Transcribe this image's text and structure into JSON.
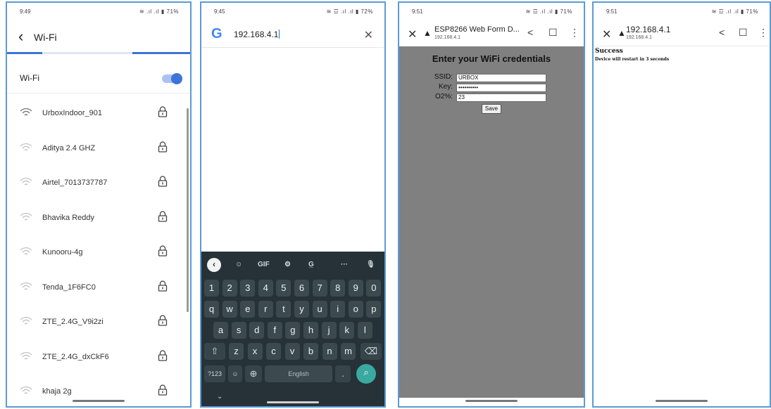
{
  "panel1": {
    "status_time": "9:49",
    "status_icons": "≋ .ıl .ıl ▮ 71%",
    "back_icon": "‹",
    "title": "Wi-Fi",
    "wifi_label": "Wi-Fi",
    "wifi_enabled": true,
    "networks": [
      {
        "name": "UrboxIndoor_901",
        "strength": "strong"
      },
      {
        "name": "Aditya 2.4 GHZ",
        "strength": "weak"
      },
      {
        "name": "Airtel_7013737787",
        "strength": "weak"
      },
      {
        "name": "Bhavika Reddy",
        "strength": "weak"
      },
      {
        "name": "Kunooru-4g",
        "strength": "weak"
      },
      {
        "name": "Tenda_1F6FC0",
        "strength": "weak"
      },
      {
        "name": "ZTE_2.4G_V9i2zi",
        "strength": "weak"
      },
      {
        "name": "ZTE_2.4G_dxCkF6",
        "strength": "weak"
      },
      {
        "name": "khaja 2g",
        "strength": "weak"
      }
    ]
  },
  "panel2": {
    "status_time": "9:45",
    "status_icons": "≋ ☲ .ıl .ıl ▮ 72%",
    "google_logo": "G",
    "url_text": "192.168.4.1",
    "close_icon": "✕",
    "toolbar": {
      "collapse": "‹",
      "sticker": "☺",
      "gif": "GIF",
      "settings": "⚙",
      "translate": "G̲",
      "more": "···",
      "mic": "🎙"
    },
    "keys_row1": [
      "1",
      "2",
      "3",
      "4",
      "5",
      "6",
      "7",
      "8",
      "9",
      "0"
    ],
    "keys_row2": [
      "q",
      "w",
      "e",
      "r",
      "t",
      "y",
      "u",
      "i",
      "o",
      "p"
    ],
    "keys_row3": [
      "a",
      "s",
      "d",
      "f",
      "g",
      "h",
      "j",
      "k",
      "l"
    ],
    "keys_row4": [
      "z",
      "x",
      "c",
      "v",
      "b",
      "n",
      "m"
    ],
    "shift_icon": "⇧",
    "backspace_icon": "⌫",
    "sym_key": "?123",
    "emoji_key": "☺",
    "globe_key": "⊕",
    "space_label": "English",
    "period_key": ".",
    "enter_icon": "⌕",
    "down_icon": "⌄"
  },
  "panel3": {
    "status_time": "9:51",
    "status_icons": "≋ ☲ .ıl .ıl ▮ 71%",
    "close_icon": "✕",
    "warning_icon": "▲",
    "title": "ESP8266 Web Form D...",
    "subtitle": "192.168.4.1",
    "share_icon": "<",
    "bookmark_icon": "☐",
    "menu_icon": "⋮",
    "page_heading": "Enter your WiFi credentials",
    "fields": [
      {
        "label": "SSID:",
        "value": "URBOX"
      },
      {
        "label": "Key:",
        "value": "••••••••••"
      },
      {
        "label": "O2%:",
        "value": "23"
      }
    ],
    "save_label": "Save"
  },
  "panel4": {
    "status_time": "9:51",
    "status_icons": "≋ ☲ .ıl .ıl ▮ 71%",
    "close_icon": "✕",
    "warning_icon": "▲",
    "title": "192.168.4.1",
    "subtitle": "192.168.4.1",
    "share_icon": "<",
    "bookmark_icon": "☐",
    "menu_icon": "⋮",
    "success_heading": "Success",
    "success_message": "Device will restart in 3 seconds"
  }
}
